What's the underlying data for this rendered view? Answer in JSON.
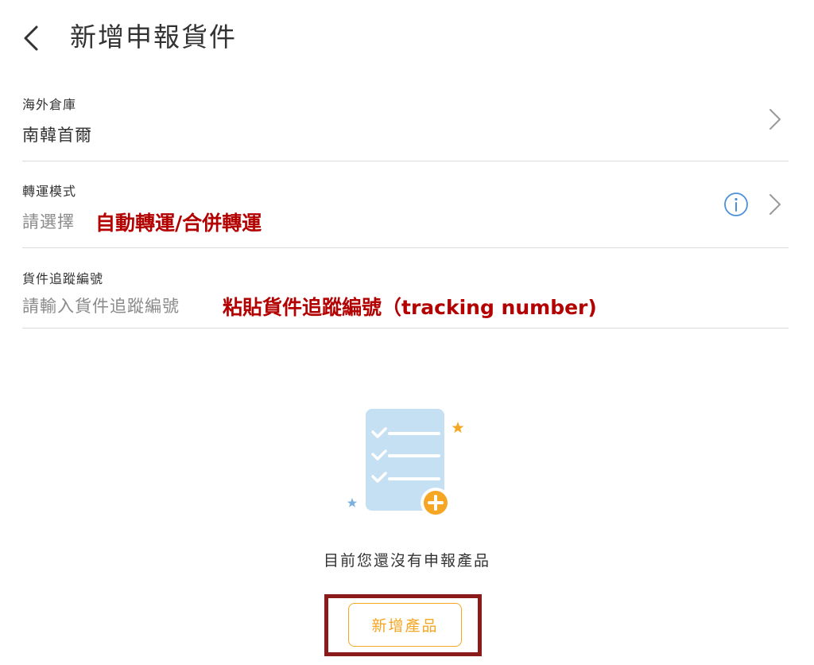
{
  "header": {
    "title": "新增申報貨件",
    "back_icon": "chevron-left-icon"
  },
  "form": {
    "warehouse": {
      "label": "海外倉庫",
      "value": "南韓首爾"
    },
    "shipping_mode": {
      "label": "轉運模式",
      "placeholder": "請選擇",
      "annotation": "自動轉運/合併轉運",
      "info_icon": "info-icon"
    },
    "tracking": {
      "label": "貨件追蹤編號",
      "placeholder": "請輸入貨件追蹤編號",
      "annotation": "粘貼貨件追蹤編號（tracking number)"
    }
  },
  "empty_state": {
    "message": "目前您還沒有申報產品",
    "illustration": "checklist-add-icon"
  },
  "actions": {
    "add_product_label": "新增產品"
  },
  "colors": {
    "accent": "#f5a623",
    "annotation": "#b30000",
    "highlight_box": "#8b1a1a",
    "info": "#4a90d9"
  }
}
